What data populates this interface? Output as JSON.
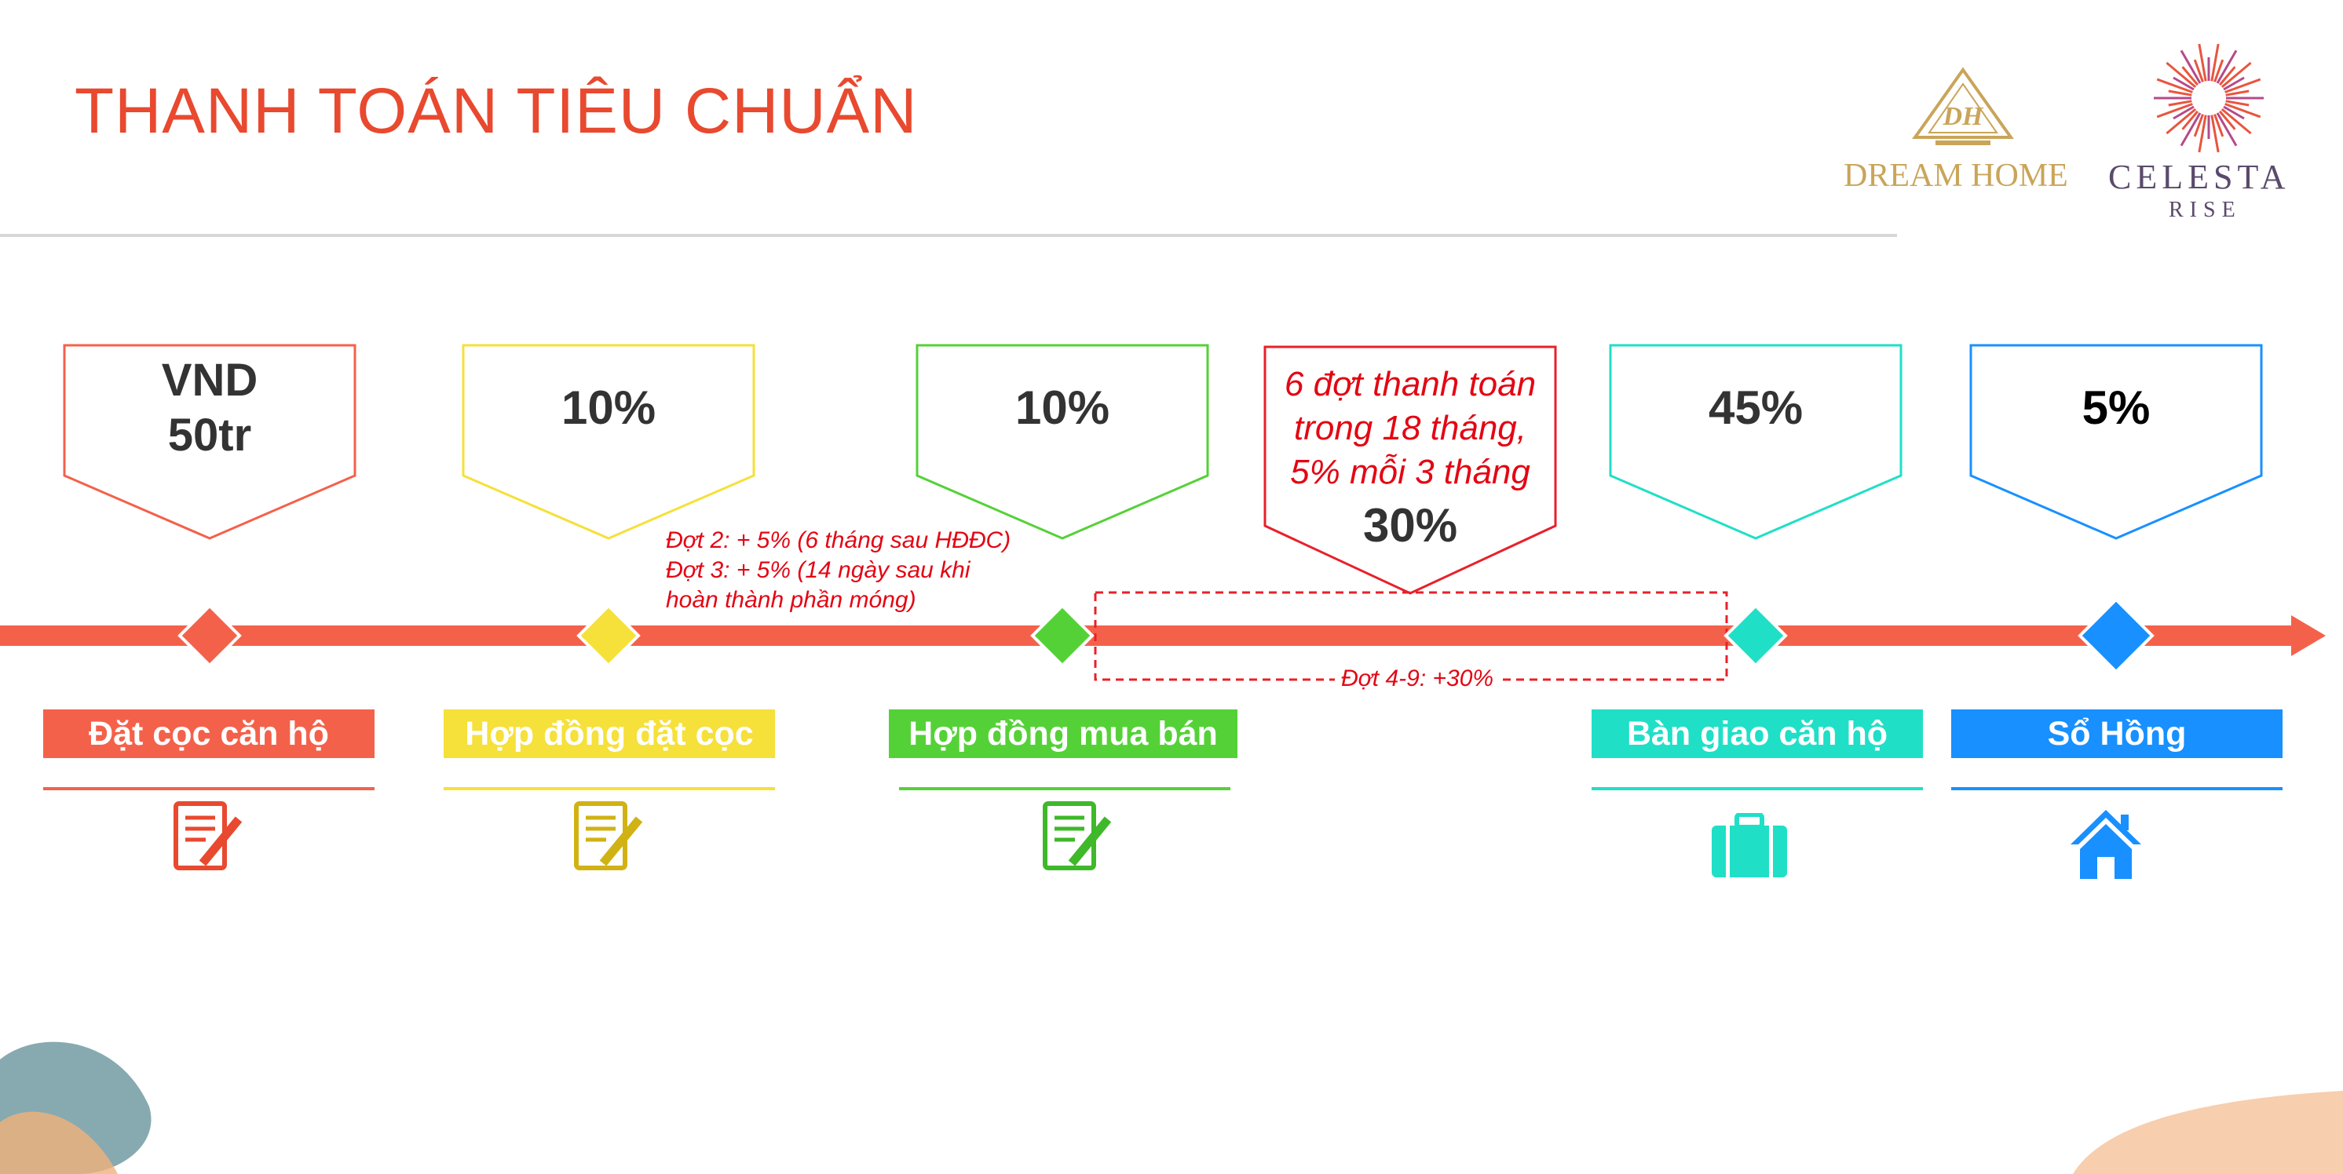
{
  "title": "THANH TOÁN TIÊU CHUẨN",
  "logos": {
    "dream_home": {
      "emblem": "DH",
      "name": "DREAM HOME",
      "color": "#c9a55a"
    },
    "celesta": {
      "name": "CELESTA",
      "sub": "RISE",
      "color": "#5a4a6b",
      "burst_color": "#e8553e"
    }
  },
  "milestones": [
    {
      "value_lines": [
        "VND",
        "50tr"
      ],
      "label": "Đặt cọc căn hộ",
      "color": "#f4614a",
      "icon": "contract-icon"
    },
    {
      "value_lines": [
        "10%"
      ],
      "label": "Hợp đồng đặt cọc",
      "color": "#f6e03a",
      "icon": "contract-icon"
    },
    {
      "value_lines": [
        "10%"
      ],
      "label": "Hợp đồng mua bán",
      "color": "#55d138",
      "icon": "contract-icon"
    },
    {
      "value_lines": [
        "45%"
      ],
      "label": "Bàn giao căn hộ",
      "color": "#20dfc7",
      "icon": "briefcase-icon"
    },
    {
      "value_lines": [
        "5%"
      ],
      "label": "Sổ Hồng",
      "color": "#1890ff",
      "icon": "house-icon"
    }
  ],
  "installments": {
    "lines": [
      "6 đợt thanh toán",
      "trong 18 tháng,",
      "5% mỗi 3 tháng"
    ],
    "value": "30%",
    "color": "#e8202a",
    "range_label": "Đợt 4-9: +30%"
  },
  "notes": [
    "Đợt 2: + 5% (6 tháng sau HĐĐC)",
    "Đợt 3: + 5% (14 ngày sau khi",
    "hoàn thành phần móng)"
  ],
  "timeline_color": "#f4614a"
}
